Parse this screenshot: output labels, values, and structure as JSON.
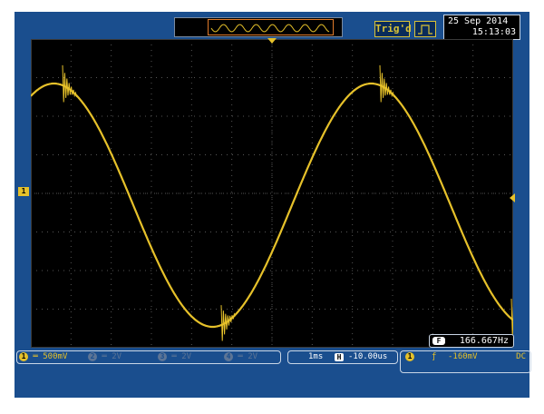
{
  "top_bar": {
    "trigger_status": "Trig'd",
    "trigger_type_icon": "pulse-icon",
    "date": "25 Sep 2014",
    "time": "15:13:03"
  },
  "channels": [
    {
      "number": "1",
      "coupling_symbol": "═",
      "scale": "500mV",
      "active": true
    },
    {
      "number": "2",
      "coupling_symbol": "═",
      "scale": "2V",
      "active": false
    },
    {
      "number": "3",
      "coupling_symbol": "═",
      "scale": "2V",
      "active": false
    },
    {
      "number": "4",
      "coupling_symbol": "═",
      "scale": "2V",
      "active": false
    }
  ],
  "ch1_marker": "1",
  "timebase": {
    "scale": "1ms",
    "pos_icon": "H",
    "position": "-10.00us"
  },
  "trigger": {
    "source": "1",
    "slope_symbol": "ƒ",
    "level": "-160mV",
    "coupling": "DC"
  },
  "frequency": {
    "icon": "F",
    "value": "166.667Hz"
  },
  "colors": {
    "trace": "#e6c12a",
    "frame": "#1a4e8e",
    "grid": "#555555",
    "window": "#e07a2a"
  }
}
